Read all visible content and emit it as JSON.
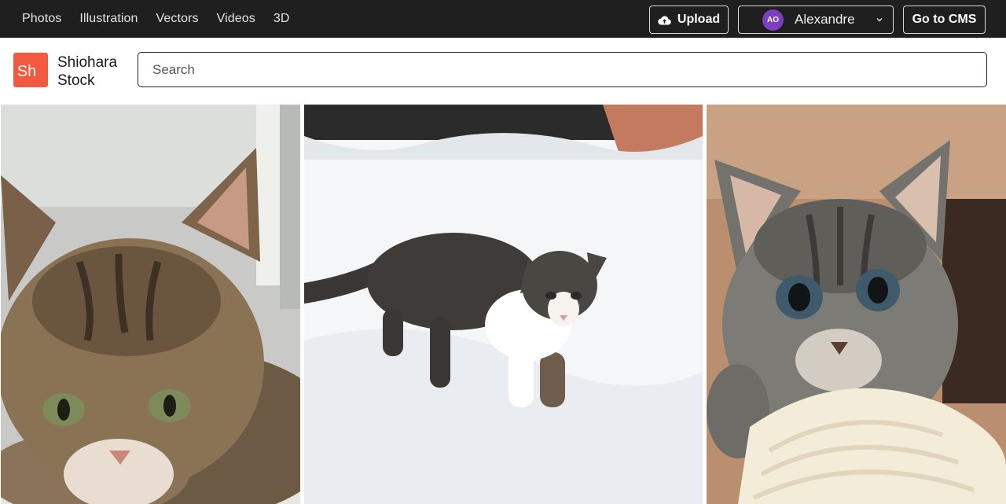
{
  "topnav": {
    "items": [
      {
        "label": "Photos"
      },
      {
        "label": "Illustration"
      },
      {
        "label": "Vectors"
      },
      {
        "label": "Videos"
      },
      {
        "label": "3D"
      }
    ]
  },
  "actions": {
    "upload_label": "Upload",
    "upload_icon": "cloud-upload-icon",
    "user_initials": "AO",
    "user_name": "Alexandre",
    "user_menu_icon": "chevron-down-icon",
    "cms_label": "Go to CMS"
  },
  "brand": {
    "logo_mark": "Sh",
    "name_line1": "Shiohara",
    "name_line2": "Stock",
    "color": "#f15a3f"
  },
  "search": {
    "placeholder": "Search",
    "value": ""
  },
  "gallery": {
    "photos": [
      {
        "subject": "tabby kitten lying down"
      },
      {
        "subject": "kitten walking in snow"
      },
      {
        "subject": "grey kitten holding white knit blanket"
      }
    ]
  },
  "colors": {
    "topbar_bg": "#1f1f1f",
    "avatar_bg": "#7b3fbf",
    "accent": "#f15a3f"
  }
}
